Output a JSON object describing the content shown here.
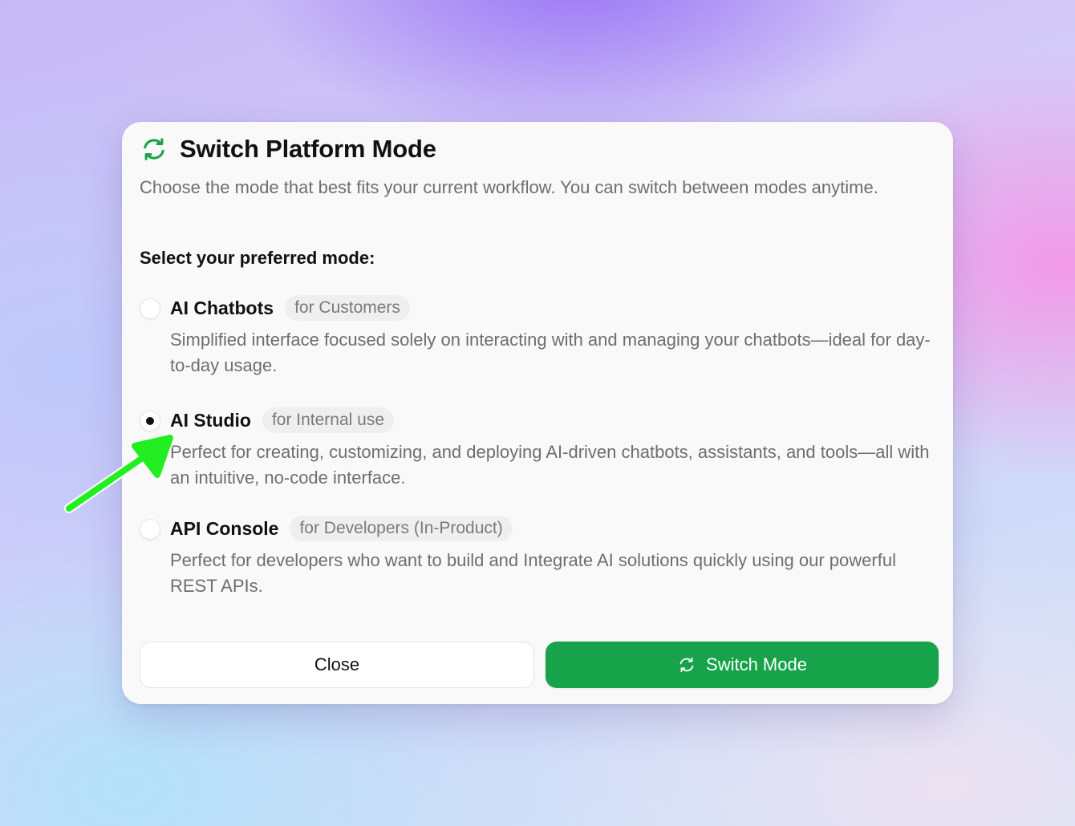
{
  "dialog": {
    "title": "Switch Platform Mode",
    "title_icon": "refresh-icon",
    "subtitle": "Choose the mode that best fits your current workflow. You can switch between modes anytime.",
    "select_label": "Select your preferred mode:",
    "accent_color": "#16a34a"
  },
  "options": [
    {
      "name": "AI Chatbots",
      "badge": "for Customers",
      "description": "Simplified interface focused solely on interacting with and managing your chatbots—ideal for day-to-day usage.",
      "selected": false
    },
    {
      "name": "AI Studio",
      "badge": "for Internal use",
      "description": "Perfect for creating, customizing, and deploying AI-driven chatbots, assistants, and tools—all with an intuitive, no-code interface.",
      "selected": true
    },
    {
      "name": "API Console",
      "badge": "for Developers (In-Product)",
      "description": "Perfect for developers who want to build and Integrate AI solutions quickly using our powerful REST APIs.",
      "selected": false
    }
  ],
  "buttons": {
    "close_label": "Close",
    "switch_label": "Switch Mode",
    "switch_icon": "refresh-icon"
  },
  "annotation": {
    "arrow_icon": "arrow-icon",
    "arrow_color": "#22ee22"
  }
}
